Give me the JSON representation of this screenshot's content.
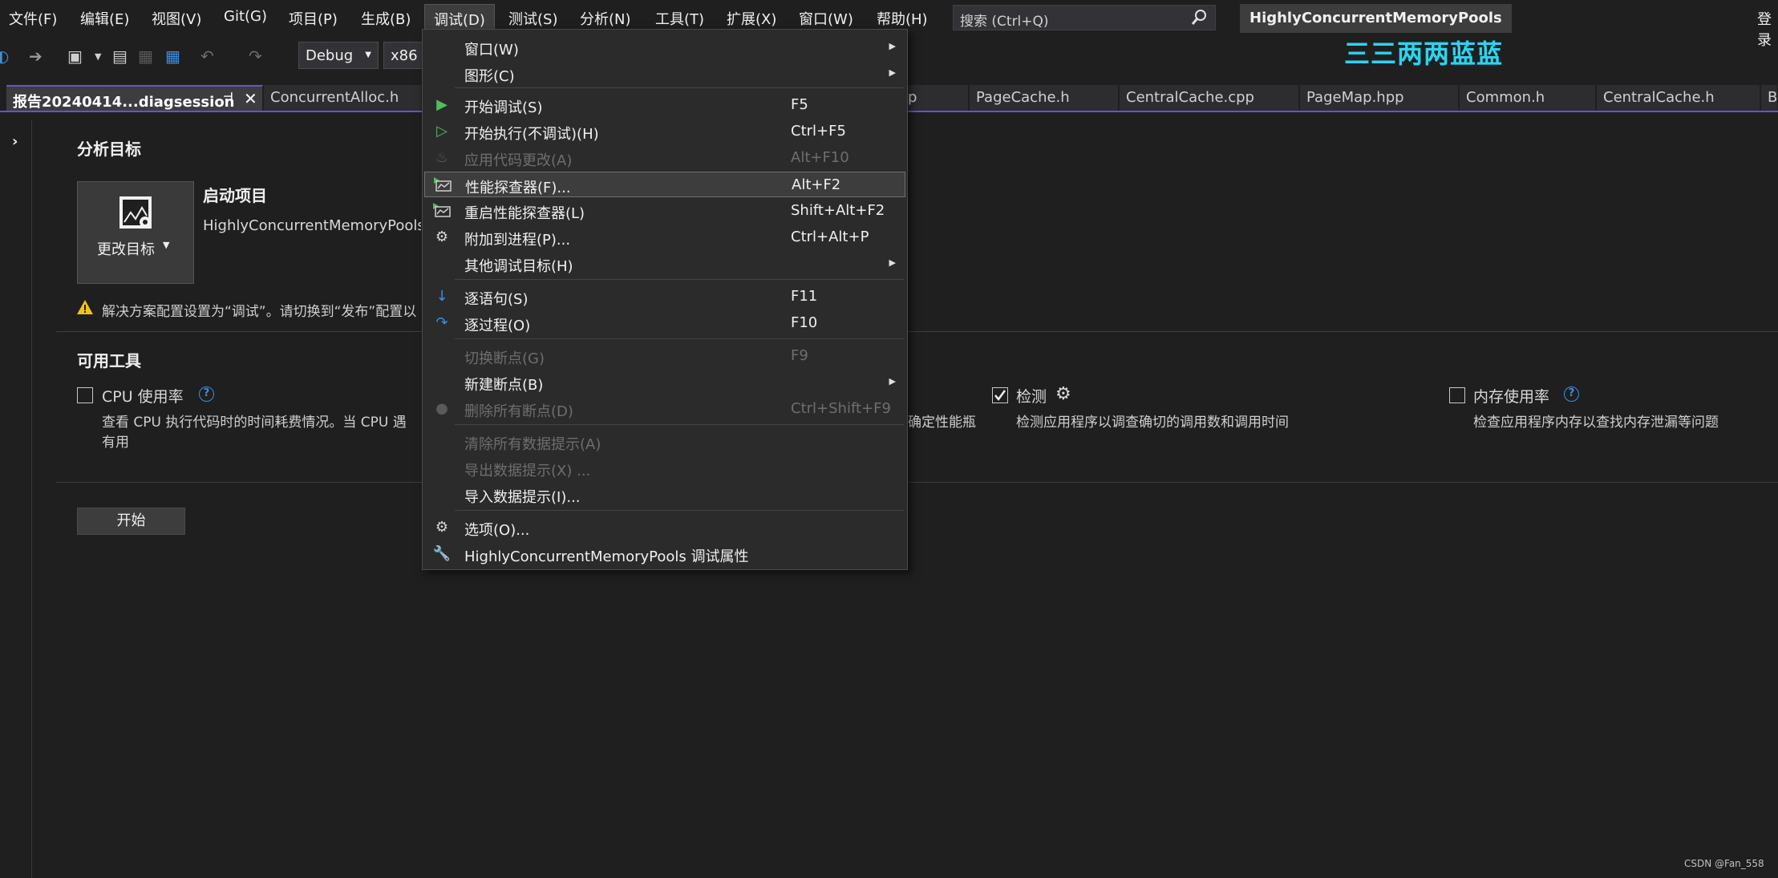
{
  "menubar": {
    "items": [
      "文件(F)",
      "编辑(E)",
      "视图(V)",
      "Git(G)",
      "项目(P)",
      "生成(B)",
      "调试(D)",
      "测试(S)",
      "分析(N)",
      "工具(T)",
      "扩展(X)",
      "窗口(W)",
      "帮助(H)"
    ],
    "search_placeholder": "搜索 (Ctrl+Q)",
    "solution_name": "HighlyConcurrentMemoryPools",
    "login": "登录",
    "brand": "三三两两蓝蓝"
  },
  "toolbar": {
    "config": "Debug",
    "platform": "x86"
  },
  "tabs": [
    {
      "label": "报告20240414...diagsession",
      "active": true
    },
    {
      "label": "ConcurrentAlloc.h"
    },
    {
      "label": "p"
    },
    {
      "label": "PageCache.h"
    },
    {
      "label": "CentralCache.cpp"
    },
    {
      "label": "PageMap.hpp"
    },
    {
      "label": "Common.h"
    },
    {
      "label": "CentralCache.h"
    },
    {
      "label": "B"
    }
  ],
  "analysis_target": {
    "heading": "分析目标",
    "change_target_label": "更改目标",
    "startup_title": "启动项目",
    "startup_value": "HighlyConcurrentMemoryPools",
    "warning": "解决方案配置设置为“调试”。请切换到“发布”配置以"
  },
  "tools": {
    "heading": "可用工具",
    "cpu": {
      "label": "CPU 使用率",
      "desc1": "查看 CPU 执行代码时的时间耗费情况。当 CPU 遇",
      "desc1_tail": "确定性能瓶",
      "desc2": "有用",
      "checked": false
    },
    "instrumentation": {
      "label": "检测",
      "desc": "检测应用程序以调查确切的调用数和调用时间",
      "checked": true
    },
    "memory": {
      "label": "内存使用率",
      "desc": "检查应用程序内存以查找内存泄漏等问题",
      "checked": false
    }
  },
  "start_button": "开始",
  "watermark": "CSDN @Fan_558",
  "debug_menu": {
    "items": [
      {
        "label": "窗口(W)",
        "shortcut": "",
        "submenu": true,
        "enabled": true,
        "icon": ""
      },
      {
        "label": "图形(C)",
        "shortcut": "",
        "submenu": true,
        "enabled": true,
        "icon": ""
      },
      {
        "label": "开始调试(S)",
        "shortcut": "F5",
        "enabled": true,
        "icon": "play-filled-icon"
      },
      {
        "label": "开始执行(不调试)(H)",
        "shortcut": "Ctrl+F5",
        "enabled": true,
        "icon": "play-outline-icon"
      },
      {
        "label": "应用代码更改(A)",
        "shortcut": "Alt+F10",
        "enabled": false,
        "icon": "flame-icon"
      },
      {
        "label": "性能探查器(F)...",
        "shortcut": "Alt+F2",
        "enabled": true,
        "highlighted": true,
        "icon": "profiler-icon"
      },
      {
        "label": "重启性能探查器(L)",
        "shortcut": "Shift+Alt+F2",
        "enabled": true,
        "icon": "profiler-icon"
      },
      {
        "label": "附加到进程(P)...",
        "shortcut": "Ctrl+Alt+P",
        "enabled": true,
        "icon": "gears-icon"
      },
      {
        "label": "其他调试目标(H)",
        "shortcut": "",
        "submenu": true,
        "enabled": true,
        "icon": ""
      },
      {
        "label": "逐语句(S)",
        "shortcut": "F11",
        "enabled": true,
        "icon": "step-into-icon"
      },
      {
        "label": "逐过程(O)",
        "shortcut": "F10",
        "enabled": true,
        "icon": "step-over-icon"
      },
      {
        "label": "切换断点(G)",
        "shortcut": "F9",
        "enabled": false,
        "icon": ""
      },
      {
        "label": "新建断点(B)",
        "shortcut": "",
        "submenu": true,
        "enabled": true,
        "icon": ""
      },
      {
        "label": "删除所有断点(D)",
        "shortcut": "Ctrl+Shift+F9",
        "enabled": false,
        "icon": "delete-breakpoints-icon"
      },
      {
        "label": "清除所有数据提示(A)",
        "shortcut": "",
        "enabled": false,
        "icon": ""
      },
      {
        "label": "导出数据提示(X) ...",
        "shortcut": "",
        "enabled": false,
        "icon": ""
      },
      {
        "label": "导入数据提示(I)...",
        "shortcut": "",
        "enabled": true,
        "icon": ""
      },
      {
        "label": "选项(O)...",
        "shortcut": "",
        "enabled": true,
        "icon": "gear-icon"
      },
      {
        "label": "HighlyConcurrentMemoryPools 调试属性",
        "shortcut": "",
        "enabled": true,
        "icon": "wrench-icon"
      }
    ]
  }
}
